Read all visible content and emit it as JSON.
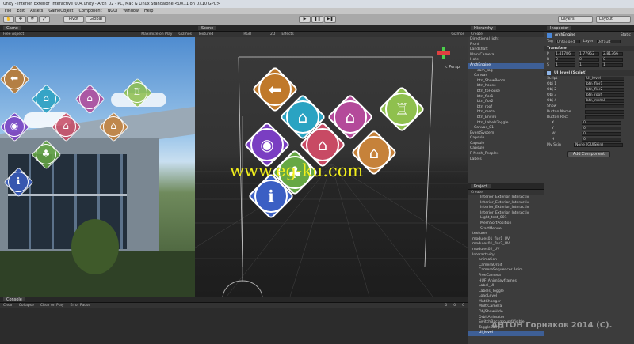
{
  "title": "Unity - Interior_Exterior_Interactive_004.unity - Arch_02 - PC, Mac & Linux Standalone <DX11 on DX10 GPU>",
  "menu": [
    "File",
    "Edit",
    "Assets",
    "GameObject",
    "Component",
    "NGUI",
    "Window",
    "Help"
  ],
  "toolbar": {
    "pivot": "Pivot",
    "global": "Global",
    "play": "▶",
    "pause": "❚❚",
    "step": "▶❚",
    "layers": "Layers",
    "layout": "Layout"
  },
  "game": {
    "tab": "Game",
    "aspect": "Free Aspect",
    "maximize": "Maximize on Play",
    "gizmos": "Gizmos"
  },
  "scene": {
    "tab": "Scene",
    "mode": "Textured",
    "rgb": "RGB",
    "twod": "2D",
    "effects": "Effects",
    "gizmos": "Gizmos",
    "persp": "< Persp"
  },
  "watermark": "www.eg-ku.com",
  "author": "АНТОН Горнаков 2014 (С).",
  "hierarchy": {
    "tab": "Hierarchy",
    "create": "Create",
    "items": [
      "Directional light",
      "Front",
      "Landshaft",
      "Main Camera",
      "Hotel",
      "ArchEngine",
      "cam_tag",
      "Canvas",
      "btn_ShowRoom",
      "btn_house",
      "btn_toHouse",
      "btn_flor1",
      "btn_flor2",
      "btn_roof",
      "btn_metal",
      "btn_Enviro",
      "btn_LabelsToggle",
      "Canvas_01",
      "EventSystem",
      "Capsule",
      "Capsule",
      "Capsule",
      "F-Mesh_Peoples",
      "Labels"
    ],
    "selected": 5
  },
  "project": {
    "tab": "Project",
    "create": "Create",
    "items": [
      "Interior_Exterior_Interactiv",
      "Interior_Exterior_Interactiv",
      "Interior_Exterior_Interactiv",
      "Interior_Exterior_Interactiv",
      "Light_test_001",
      "MeshSortPosition",
      "StartMenue",
      "textures",
      "modules01_flor1_UV",
      "modules01_flor2_UV",
      "modules02_UV",
      "Interactivity",
      "animation",
      "CameraOrbit",
      "CameraSequencer.Anim",
      "FreeCamera",
      "HUF_AnimKeyframes",
      "Label_UI",
      "Labels_Toggle",
      "LoadLevel",
      "MatChanger",
      "MultiCamera",
      "ObjShowHide",
      "OrbitAnimator",
      "SwitchBackgroundVisible",
      "ToggleSample",
      "UI_level"
    ],
    "selected": 26
  },
  "console": {
    "tab": "Console",
    "buttons": [
      "Clear",
      "Collapse",
      "Clear on Play",
      "Error Pause"
    ],
    "counts": [
      "0",
      "0",
      "0"
    ]
  },
  "inspector": {
    "tab": "Inspector",
    "name": "ArchEngine",
    "static": "Static",
    "tag_label": "Tag",
    "tag": "Untagged",
    "layer_label": "Layer",
    "layer": "Default",
    "transform": "Transform",
    "rows": [
      {
        "l": "P",
        "x": "1.41786",
        "y": "1.77952",
        "z": "2.81366"
      },
      {
        "l": "R",
        "x": "0",
        "y": "0",
        "z": "0"
      },
      {
        "l": "S",
        "x": "1",
        "y": "1",
        "z": "1"
      }
    ],
    "script_header": "UI_level (Script)",
    "fields": [
      {
        "k": "Script",
        "v": "UI_level"
      },
      {
        "k": "Obj 1",
        "v": "btn_flor1"
      },
      {
        "k": "Obj 2",
        "v": "btn_flor2"
      },
      {
        "k": "Obj 3",
        "v": "btn_roof"
      },
      {
        "k": "Obj 4",
        "v": "btn_metal"
      },
      {
        "k": "Show",
        "v": ""
      },
      {
        "k": "Button Name",
        "v": ""
      },
      {
        "k": "Button Rect",
        "v": ""
      }
    ],
    "rect": [
      {
        "k": "X",
        "v": "0"
      },
      {
        "k": "Y",
        "v": "0"
      },
      {
        "k": "W",
        "v": "0"
      },
      {
        "k": "H",
        "v": "0"
      }
    ],
    "skin_label": "My Skin",
    "skin": "None (GUISkin)",
    "add_component": "Add Component"
  },
  "tiles": [
    {
      "c": "#c0792a",
      "icon": "⬅"
    },
    {
      "c": "#2aa3c2",
      "icon": "⌂"
    },
    {
      "c": "#b44a9a",
      "icon": "⌂"
    },
    {
      "c": "#8fc04e",
      "icon": "♖"
    },
    {
      "c": "#7a3ec2",
      "icon": "◉"
    },
    {
      "c": "#c84a64",
      "icon": "⌂"
    },
    {
      "c": "#c6823a",
      "icon": "⌂"
    },
    {
      "c": "#66a844",
      "icon": "♣"
    },
    {
      "c": "#3b5fc4",
      "icon": "ℹ"
    }
  ]
}
